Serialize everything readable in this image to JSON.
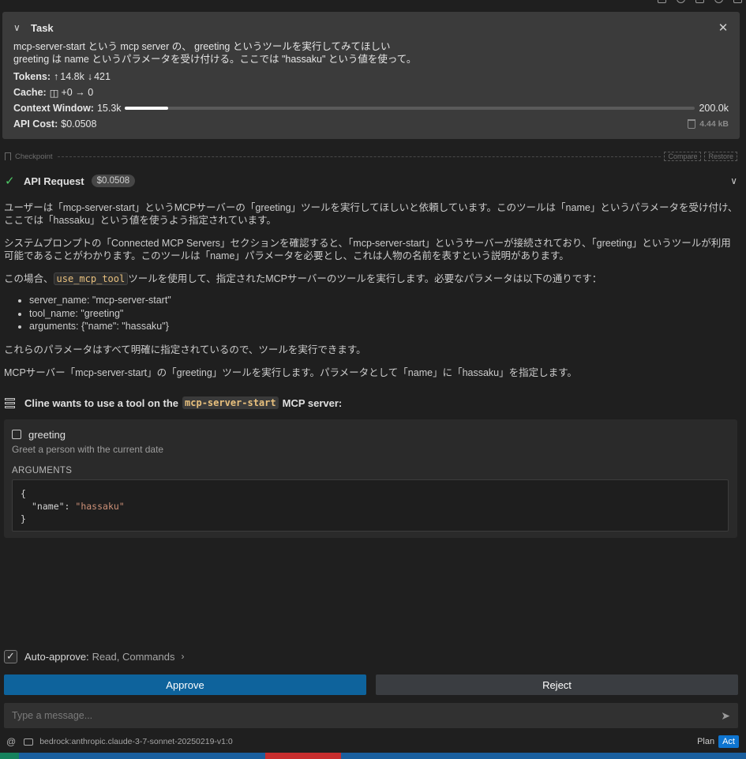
{
  "task": {
    "title": "Task",
    "line1": "mcp-server-start という mcp server の、 greeting というツールを実行してみてほしい",
    "line2": "greeting は name というパラメータを受け付ける。ここでは \"hassaku\" という値を使って。",
    "tokens_label": "Tokens:",
    "tokens_up": "14.8k",
    "tokens_down": "421",
    "cache_label": "Cache:",
    "cache_value": "+0 → 0",
    "context_label": "Context Window:",
    "context_used": "15.3k",
    "context_max": "200.0k",
    "context_fraction": 0.0765,
    "api_cost_label": "API Cost:",
    "api_cost_value": "$0.0508",
    "size": "4.44 kB"
  },
  "checkpoint": {
    "label": "Checkpoint",
    "compare": "Compare",
    "restore": "Restore"
  },
  "api_request": {
    "title": "API Request",
    "cost": "$0.0508"
  },
  "message": {
    "p1": "ユーザーは「mcp-server-start」というMCPサーバーの「greeting」ツールを実行してほしいと依頼しています。このツールは「name」というパラメータを受け付け、ここでは「hassaku」という値を使うよう指定されています。",
    "p2": "システムプロンプトの「Connected MCP Servers」セクションを確認すると、「mcp-server-start」というサーバーが接続されており、「greeting」というツールが利用可能であることがわかります。このツールは「name」パラメータを必要とし、これは人物の名前を表すという説明があります。",
    "p3_pre": "この場合、",
    "p3_code": "use_mcp_tool",
    "p3_post": "ツールを使用して、指定されたMCPサーバーのツールを実行します。必要なパラメータは以下の通りです：",
    "list": [
      "server_name: \"mcp-server-start\"",
      "tool_name: \"greeting\"",
      "arguments: {\"name\": \"hassaku\"}"
    ],
    "p4": "これらのパラメータはすべて明確に指定されているので、ツールを実行できます。",
    "p5": "MCPサーバー「mcp-server-start」の「greeting」ツールを実行します。パラメータとして「name」に「hassaku」を指定します。"
  },
  "tool": {
    "head_pre": "Cline wants to use a tool on the",
    "server": "mcp-server-start",
    "head_post": "MCP server:",
    "name": "greeting",
    "description": "Greet a person with the current date",
    "args_label": "ARGUMENTS",
    "code_open": "{",
    "code_key": "\"name\"",
    "code_colon": ": ",
    "code_value": "\"hassaku\"",
    "code_close": "}"
  },
  "auto_approve": {
    "label": "Auto-approve:",
    "value": "Read, Commands",
    "checked": true
  },
  "buttons": {
    "approve": "Approve",
    "reject": "Reject"
  },
  "input": {
    "placeholder": "Type a message..."
  },
  "footer": {
    "at": "@",
    "model": "bedrock:anthropic.claude-3-7-sonnet-20250219-v1:0",
    "plan": "Plan",
    "act": "Act"
  },
  "colors": {
    "accent": "#0e639c",
    "success": "#4ec966",
    "code_string": "#ce9178",
    "statusbar": "#1a5f9e"
  }
}
